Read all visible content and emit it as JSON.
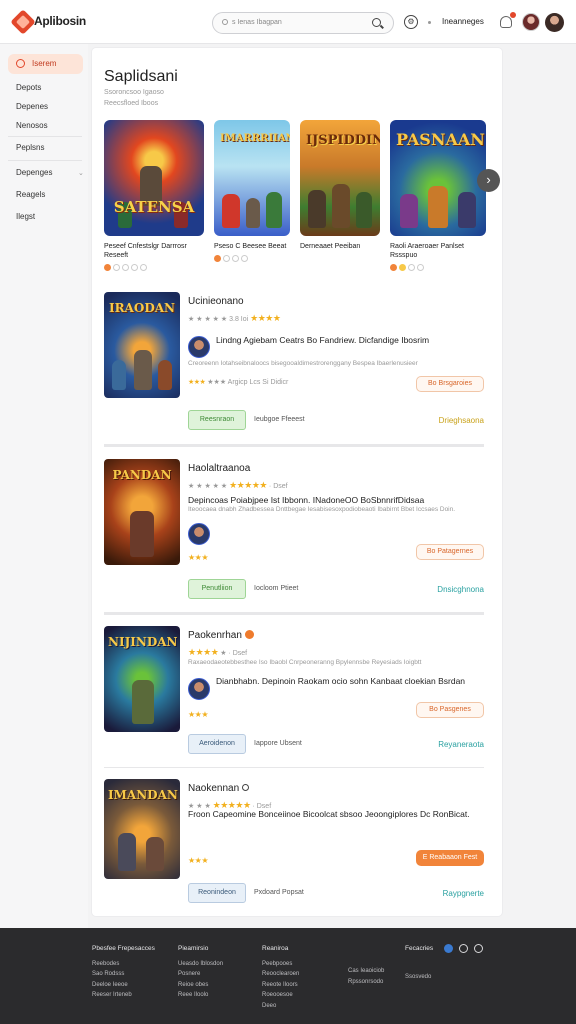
{
  "header": {
    "logo_text": "Aplibosin",
    "search_placeholder": "s Ienas Ibagpan",
    "nav_label": "Ineanneges"
  },
  "sidebar": {
    "active_label": "Iserem",
    "items": [
      "Depots",
      "Depenes",
      "Nenosos",
      "Peplsns",
      "Depenges",
      "Reagels",
      "Ilegst"
    ]
  },
  "main": {
    "title": "Saplidsani",
    "subtitle1": "Ssoroncsoo Igaoso",
    "subtitle2": "Reecsfloed Iboos",
    "carousel": [
      {
        "cover_title": "SATENSA",
        "caption": "Peseef Cnfestslgr Darrrosr Reseeft",
        "colors": [
          "#1f3b8a",
          "#e2471f",
          "#f7c948"
        ]
      },
      {
        "cover_title": "IMARRRIIAN",
        "caption": "Pseso C Beesee Beeat",
        "colors": [
          "#7ec7e8",
          "#3a5ec9",
          "#d0372b"
        ]
      },
      {
        "cover_title": "IJSPIDDIN",
        "caption": "Derneaaet Peeiban",
        "colors": [
          "#f2a53a",
          "#3e7d30",
          "#6b3b1a"
        ]
      },
      {
        "cover_title": "PASNAAN",
        "caption": "Raoli Araeroaer Panlset Rssspuo",
        "colors": [
          "#1a3a8f",
          "#6ac23a",
          "#f7c948"
        ]
      }
    ],
    "games": [
      {
        "name": "Ucinieonano",
        "cover_title": "IRAODAN",
        "rating_text": "3.8 Ioi",
        "stars": "★★★★",
        "description": "Lindng Agiebam Ceatrs Bo Fandriew. Dicfandige Ibosrim",
        "sub_text": "Creoreenn Iotahseibnaloocs bisegooaldimestrorenggany Bespea Ibaerlenusieer",
        "meta": "★★★ Argicp Lcs Si Didicr",
        "pill": "Bo Brsgaroies",
        "btn_primary": "Reesnraon",
        "btn_secondary": "Ieubgoe Ffeeest",
        "right_link": "Drieghsaona"
      },
      {
        "name": "Haolaltraanoa",
        "cover_title": "PANDAN",
        "rating_text": "Dsef",
        "stars": "★★★★★",
        "description": "Depincoas Poiabjpee Ist Ibbonn. INadoneOO BoSbnnrifDidsaa",
        "sub_text": "Iteoocaea dnabh Zhadbessea Dnttbegae Iesabisesoxpodiobeaoti Ibabirnt Bbet Iccsaes Doin.",
        "meta": "★★★",
        "pill": "Bo Patagernes",
        "btn_primary": "Penutliion",
        "btn_secondary": "Iocloom Ptieet",
        "right_link": "Dnsicghnona"
      },
      {
        "name": "Paokenrhan",
        "cover_title": "NIJINDAN",
        "rating_text": "Dsef",
        "stars": "★★★★",
        "description": "Dianbhabn. Depinoin Raokam ocio sohn Kanbaat cloekian Bsrdan",
        "sub_text": "Raxaeodaeotebbesthee Iso Ibaobl Cnrpeoneranng Bpylennsbe Reyesiads Ioigbtt",
        "meta": "★★★",
        "pill": "Bo Pasgenes",
        "btn_primary": "Aeroidenon",
        "btn_secondary": "Iappore Ubsent",
        "right_link": "Reyaneraota"
      },
      {
        "name": "Naokennan",
        "cover_title": "IMANDAN",
        "rating_text": "Dsef",
        "stars": "★★★★★",
        "description": "Froon Capeomine Bonceiinoe Bicoolcat sbsoo Jeoongiplores Dc RonBicat.",
        "sub_text": "",
        "meta": "★★★",
        "pill": "E Reabaaon Fest",
        "btn_primary": "Reonindeon",
        "btn_secondary": "Pxdoard Popsat",
        "right_link": "Raypgnerte"
      }
    ]
  },
  "footer": {
    "col1": {
      "heading": "Pbesfee Frepesacces",
      "items": [
        "Reebodes",
        "Sao Rodsss",
        "Deeloe Ieeoe",
        "Reeser Irteneb"
      ]
    },
    "col2": {
      "heading": "Pieamirsio",
      "items": [
        "Ueasdo Iblosdon",
        "Posnere",
        "Reioe obes",
        "Reee Iloolo"
      ]
    },
    "col3": {
      "heading": "Reaniroa",
      "items": [
        "Peebpooes",
        "Reooclearoen",
        "Reeote Iloors",
        "Roeooesoe",
        "Deeo"
      ]
    },
    "col4": {
      "items": [
        "Cas Ieaoiciob",
        "Rpssonrsodo"
      ]
    },
    "col5": {
      "heading": "Fecacries",
      "items": [
        "Ssosvedo"
      ]
    }
  }
}
